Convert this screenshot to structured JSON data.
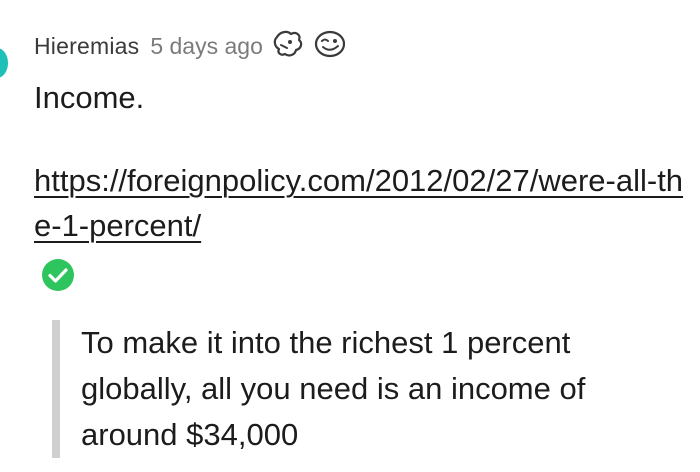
{
  "comment": {
    "author": "Hieremias",
    "timestamp": "5 days ago",
    "flair_icons": [
      "duck-icon",
      "wink-face-icon"
    ],
    "body": "Income.",
    "link_text": "https://foreignpolicy.com/2012/02/27/were-all-the-1-percent/",
    "verified_icon": "check-circle-icon",
    "quote": "To make it into the richest 1 percent globally, all you need is an income of around $34,000"
  },
  "colors": {
    "thread_accent": "#1fc0b8",
    "check": "#2fc55e",
    "quote_bar": "#cfcfcf"
  }
}
